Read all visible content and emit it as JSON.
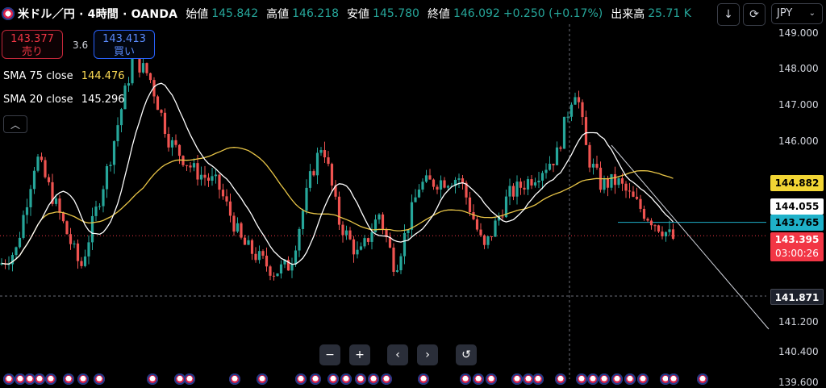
{
  "header": {
    "symbol": "米ドル／円 · 4時間 · OANDA",
    "open_label": "始値",
    "open_value": "145.842",
    "high_label": "高値",
    "high_value": "146.218",
    "low_label": "安値",
    "low_value": "145.780",
    "close_label": "終値",
    "close_value": "146.092",
    "change": "+0.250 (+0.17%)",
    "volume_label": "出来高",
    "volume_value": "25.71 K"
  },
  "trade": {
    "sell_price": "143.377",
    "sell_label": "売り",
    "spread": "3.6",
    "buy_price": "143.413",
    "buy_label": "買い"
  },
  "indicators": {
    "sma75_label": "SMA 75 close",
    "sma75_value": "144.476",
    "sma20_label": "SMA 20 close",
    "sma20_value": "145.296"
  },
  "toolbar": {
    "currency": "JPY"
  },
  "price_axis": {
    "ticks": [
      "149.000",
      "148.000",
      "147.000",
      "146.000",
      "141.200",
      "140.400",
      "139.600"
    ],
    "tags": {
      "sma75": "144.882",
      "sma20": "144.055",
      "line": "143.765",
      "last": "143.395",
      "countdown": "03:00:26",
      "crosshair": "141.871"
    }
  },
  "colors": {
    "up": "#26a69a",
    "down": "#ef5350",
    "sma75": "#e8c547",
    "sma20": "#ffffff",
    "line_tag": "#1fb1c9",
    "last_tag": "#f23645",
    "background": "#000000"
  },
  "icons": {
    "flag": "us-flag-icon",
    "collapse": "chevron-up-icon",
    "down_arrow": "arrow-down-icon",
    "refresh": "refresh-icon",
    "minus": "zoom-out-icon",
    "plus": "zoom-in-icon",
    "left": "chevron-left-icon",
    "right": "chevron-right-icon",
    "reset": "reset-icon",
    "event": "economic-event-icon"
  }
}
